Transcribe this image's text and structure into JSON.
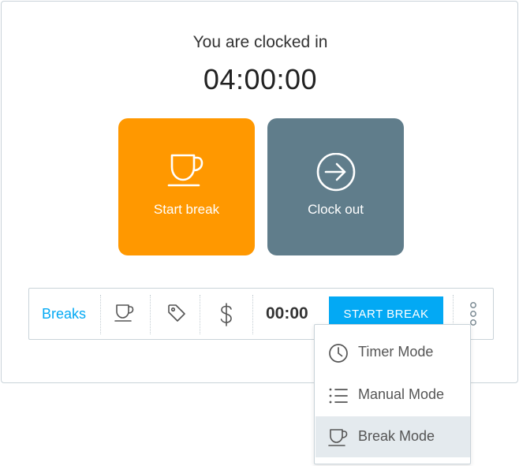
{
  "status": {
    "message": "You are clocked in",
    "elapsed": "04:00:00"
  },
  "actions": {
    "start_break": {
      "label": "Start break",
      "icon": "coffee-cup-icon",
      "color": "#ff9800"
    },
    "clock_out": {
      "label": "Clock out",
      "icon": "arrow-circle-right-icon",
      "color": "#607d8b"
    }
  },
  "toolbar": {
    "mode_label": "Breaks",
    "icons": [
      "coffee-cup-icon",
      "tag-icon",
      "dollar-icon"
    ],
    "timer": "00:00",
    "start_break_button": "START BREAK",
    "more_icon": "vertical-dots-icon",
    "accent": "#03a9f4"
  },
  "mode_menu": {
    "items": [
      {
        "label": "Timer Mode",
        "icon": "clock-icon"
      },
      {
        "label": "Manual Mode",
        "icon": "list-icon"
      },
      {
        "label": "Break Mode",
        "icon": "coffee-cup-icon",
        "selected": true
      }
    ]
  }
}
